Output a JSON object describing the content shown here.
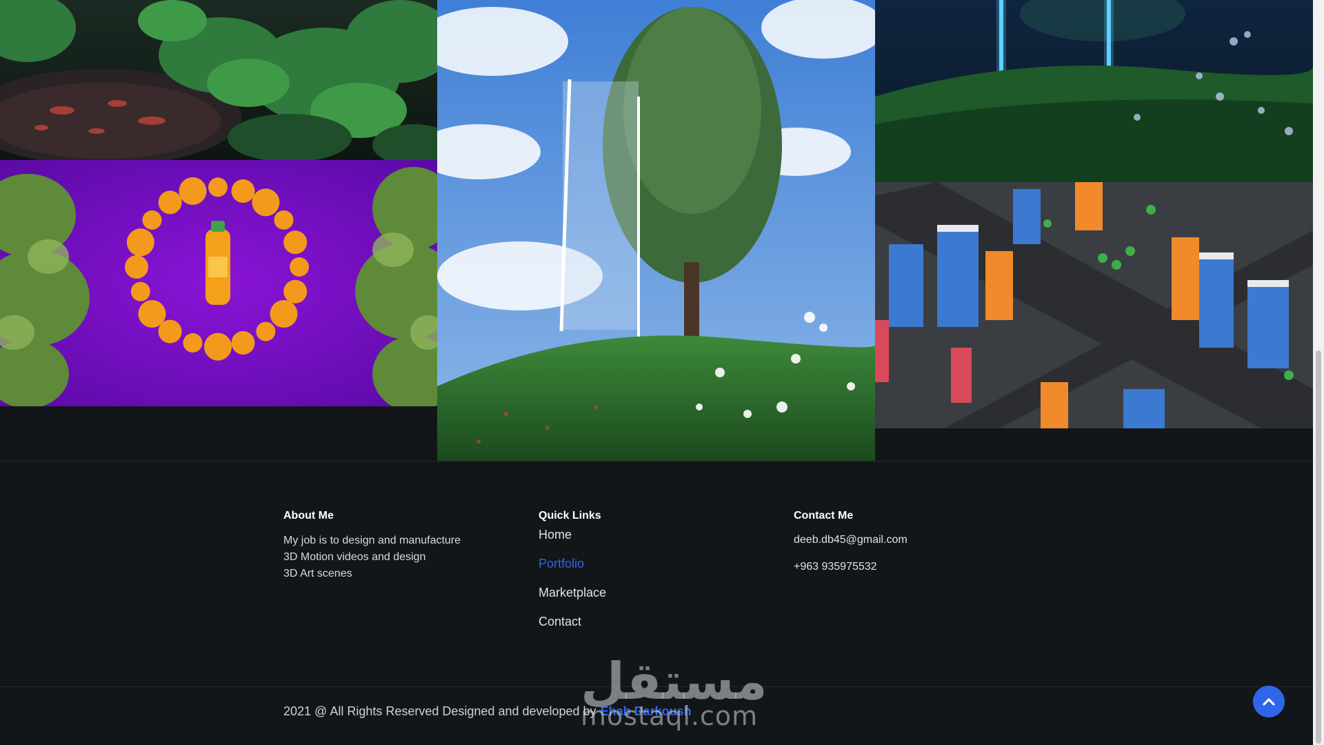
{
  "gallery": {
    "items": [
      {
        "name": "garden-render"
      },
      {
        "name": "orange-juice-render"
      },
      {
        "name": "tree-mirror-render"
      },
      {
        "name": "neon-lights-render"
      },
      {
        "name": "low-poly-city-render"
      }
    ]
  },
  "footer": {
    "about": {
      "title": "About Me",
      "lines": [
        "My job is to design and manufacture",
        "3D Motion videos and design",
        "3D Art scenes"
      ]
    },
    "quick_links": {
      "title": "Quick Links",
      "items": [
        {
          "label": "Home",
          "active": false
        },
        {
          "label": "Portfolio",
          "active": true
        },
        {
          "label": "Marketplace",
          "active": false
        },
        {
          "label": "Contact",
          "active": false
        }
      ]
    },
    "contact": {
      "title": "Contact Me",
      "email": "deeb.db45@gmail.com",
      "phone": "+963 935975532"
    }
  },
  "copyright": {
    "text": "2021 @ All Rights Reserved Designed and developed by",
    "author": "Ehab Darkoush"
  },
  "watermark": {
    "arabic": "مستقل",
    "latin": "mostaql.com"
  },
  "icons": {
    "back_to_top": "chevron-up-icon"
  },
  "colors": {
    "background": "#121619",
    "accent": "#2f66e8",
    "text": "#dfe3e6"
  }
}
